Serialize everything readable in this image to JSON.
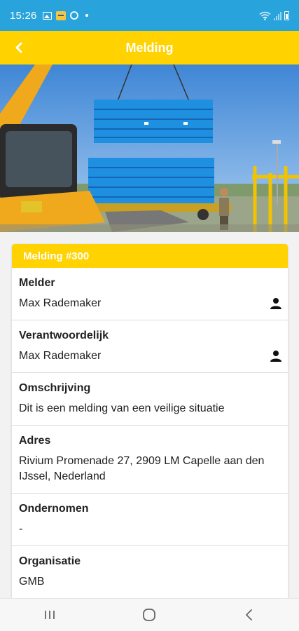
{
  "status_bar": {
    "time": "15:26",
    "icons": [
      "image-icon",
      "app-notification-icon",
      "sync-ring-icon",
      "dot-icon",
      "wifi-icon",
      "signal-icon",
      "battery-icon"
    ]
  },
  "app_bar": {
    "title": "Melding",
    "back_icon": "chevron-left-icon"
  },
  "hero_image": {
    "description_icon": "photo"
  },
  "card": {
    "header": "Melding #300",
    "fields": [
      {
        "label": "Melder",
        "value": "Max Rademaker",
        "icon": "person-icon"
      },
      {
        "label": "Verantwoordelijk",
        "value": "Max Rademaker",
        "icon": "person-icon"
      },
      {
        "label": "Omschrijving",
        "value": "Dit is een melding van een veilige situatie"
      },
      {
        "label": "Adres",
        "value": "Rivium Promenade 27, 2909 LM Capelle aan den IJssel, Nederland"
      },
      {
        "label": "Ondernomen",
        "value": "-"
      },
      {
        "label": "Organisatie",
        "value": "GMB"
      }
    ]
  },
  "nav_bar": {
    "buttons": [
      "recent-apps-icon",
      "home-icon",
      "back-icon"
    ]
  },
  "colors": {
    "status_bar": "#29a3dc",
    "accent_yellow": "#ffd200",
    "background": "#f2f2f2"
  }
}
